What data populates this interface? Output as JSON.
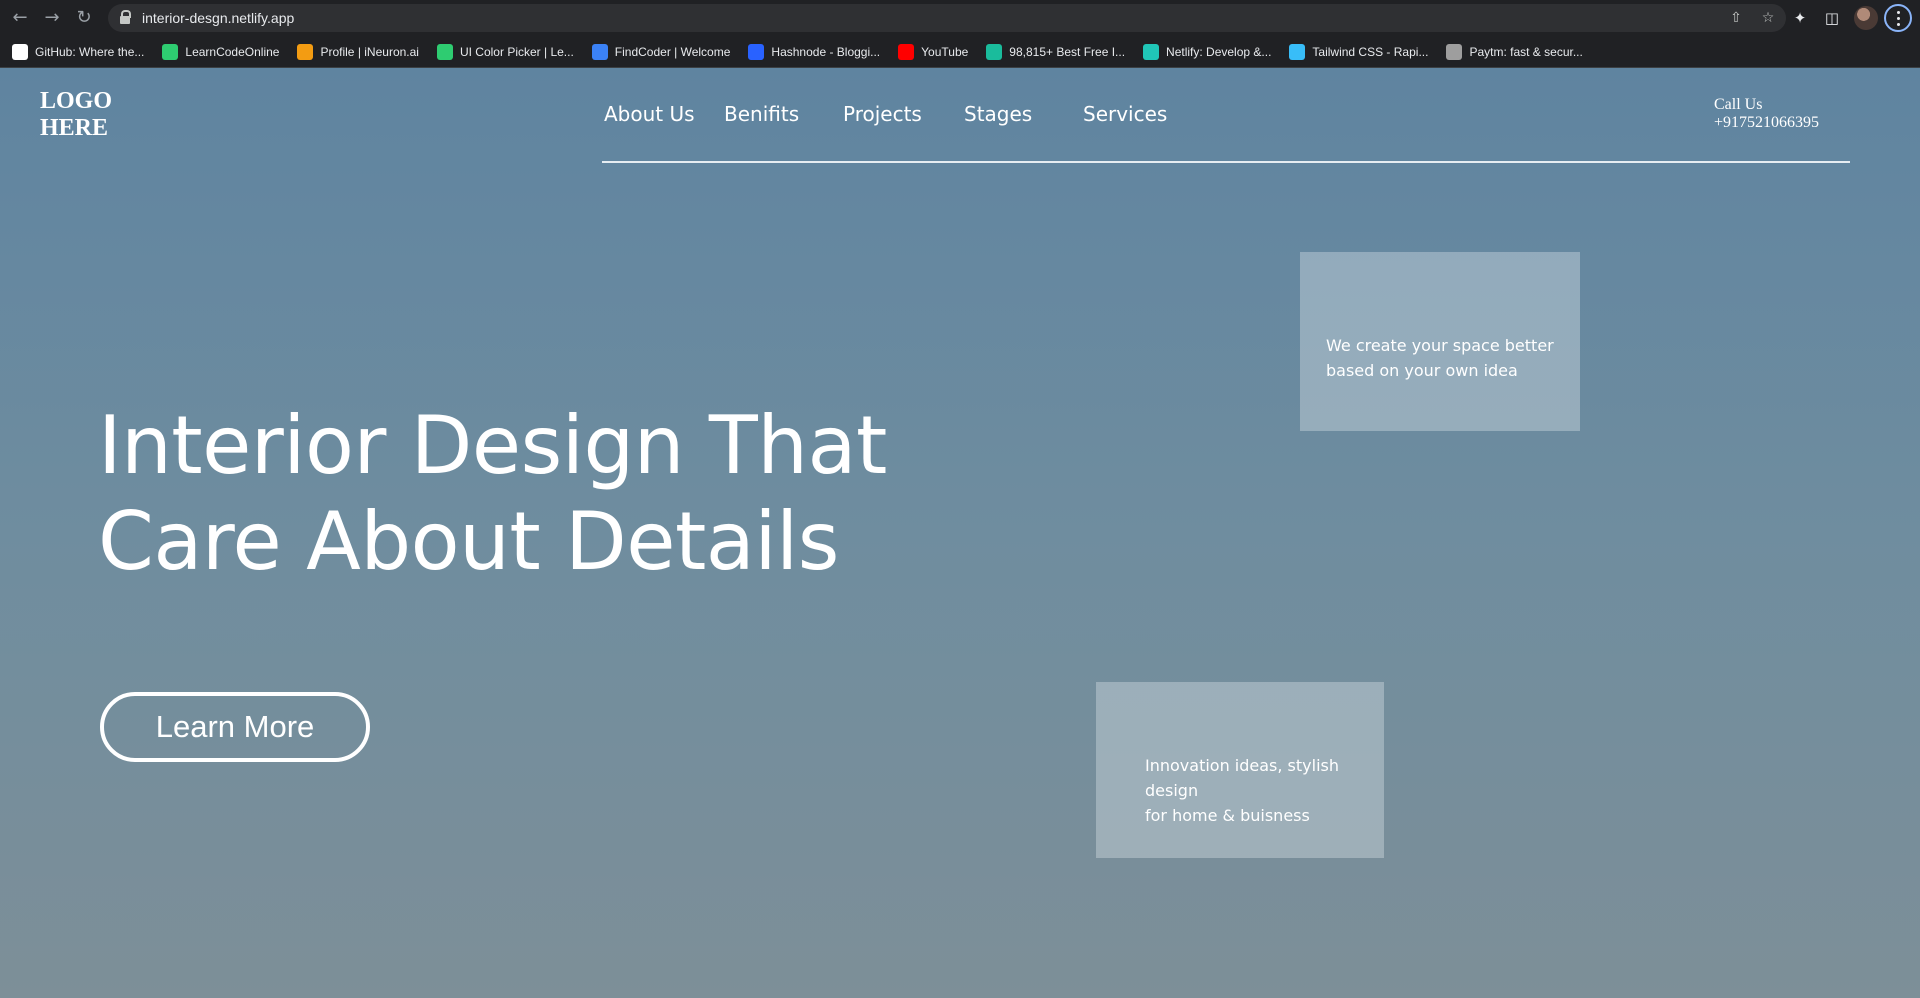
{
  "browser": {
    "url": "interior-desgn.netlify.app",
    "bookmarks": [
      {
        "label": "GitHub: Where the...",
        "icon": "github-icon",
        "color": "#ffffff"
      },
      {
        "label": "LearnCodeOnline",
        "icon": "learncodeonline-icon",
        "color": "#2ecc71"
      },
      {
        "label": "Profile | iNeuron.ai",
        "icon": "ineuron-icon",
        "color": "#f39c12"
      },
      {
        "label": "UI Color Picker | Le...",
        "icon": "learncodeonline-icon",
        "color": "#2ecc71"
      },
      {
        "label": "FindCoder | Welcome",
        "icon": "findcoder-icon",
        "color": "#3b82f6"
      },
      {
        "label": "Hashnode - Bloggi...",
        "icon": "hashnode-icon",
        "color": "#2962ff"
      },
      {
        "label": "YouTube",
        "icon": "youtube-icon",
        "color": "#ff0000"
      },
      {
        "label": "98,815+ Best Free I...",
        "icon": "freepik-icon",
        "color": "#1abc9c"
      },
      {
        "label": "Netlify: Develop &...",
        "icon": "netlify-icon",
        "color": "#20c6b7"
      },
      {
        "label": "Tailwind CSS - Rapi...",
        "icon": "tailwind-icon",
        "color": "#38bdf8"
      },
      {
        "label": "Paytm: fast & secur...",
        "icon": "paytm-icon",
        "color": "#9e9e9e"
      }
    ]
  },
  "site": {
    "logo": "LOGO\nHERE",
    "nav": [
      "About Us",
      "Benifits",
      "Projects",
      "Stages",
      "Services"
    ],
    "call_label": "Call Us",
    "phone": "+917521066395",
    "hero_title": "Interior Design That Care About Details",
    "cta_label": "Learn More",
    "card1_text": "We create your space better based on your own idea",
    "card2_line1": "Innovation ideas, stylish design",
    "card2_line2": "for home & buisness"
  }
}
